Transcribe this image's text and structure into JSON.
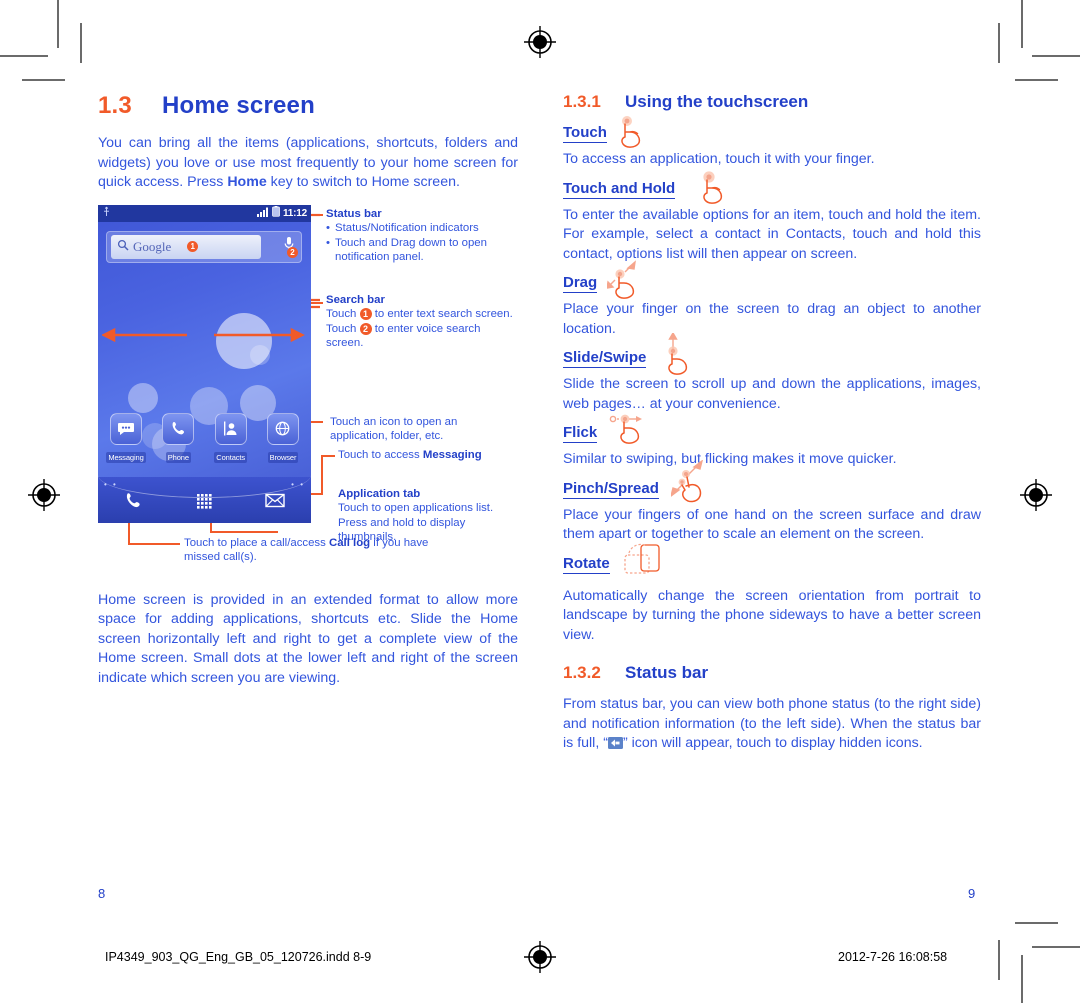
{
  "document": {
    "left_page_number": "8",
    "right_page_number": "9",
    "footer_filename": "IP4349_903_QG_Eng_GB_05_120726.indd   8-9",
    "footer_timestamp": "2012-7-26   16:08:58"
  },
  "colors": {
    "accent_orange": "#F15A29",
    "heading_blue": "#2340C8",
    "body_blue": "#3355DD",
    "phone_bg": "#4a63e0",
    "status_bar": "#21379f"
  },
  "left_column": {
    "section": {
      "number": "1.3",
      "title": "Home screen"
    },
    "intro_paragraph": "You can bring all the items (applications, shortcuts, folders and widgets) you love or use most frequently to your home screen for quick access. Press ",
    "intro_bold": "Home",
    "intro_paragraph_tail": " key to switch to Home screen.",
    "closing_paragraph": "Home screen is provided in an extended format to allow more space for adding applications, shortcuts etc. Slide the Home screen horizontally left and right to get a complete view of the Home screen. Small dots at the lower left and right of the screen indicate which screen you are viewing."
  },
  "phone": {
    "status_bar": {
      "time": "11:12",
      "usb_icon": "usb-icon",
      "signal_icon": "signal-bars-icon",
      "battery_icon": "battery-icon"
    },
    "search_bar": {
      "search_icon": "magnifier-icon",
      "text": "Google",
      "badge_text": "1",
      "mic_icon": "microphone-icon",
      "badge_voice": "2"
    },
    "dock_apps": [
      {
        "label": "Messaging",
        "icon": "message-bubble-icon"
      },
      {
        "label": "Phone",
        "icon": "handset-icon"
      },
      {
        "label": "Contacts",
        "icon": "person-icon"
      },
      {
        "label": "Browser",
        "icon": "globe-icon"
      }
    ],
    "bottom_bar": [
      {
        "icon": "phone-handset-icon",
        "name": "call-log-button"
      },
      {
        "icon": "app-grid-icon",
        "name": "application-tab-button"
      },
      {
        "icon": "envelope-icon",
        "name": "messaging-button"
      }
    ],
    "page_dots_left": "• •",
    "page_dots_right": "• •"
  },
  "annotations": {
    "status_bar": {
      "title": "Status bar",
      "bullets": [
        "Status/Notification indicators",
        "Touch and Drag down to open notification panel."
      ]
    },
    "search_bar": {
      "title": "Search bar",
      "line1_pre": "Touch ",
      "line1_badge": "1",
      "line1_post": " to enter text search screen.",
      "line2_pre": "Touch ",
      "line2_badge": "2",
      "line2_post": " to enter voice search screen."
    },
    "icon_note": "Touch an icon to open an application, folder, etc.",
    "messaging_note_pre": "Touch to access ",
    "messaging_note_bold": "Messaging",
    "application_tab": {
      "title": "Application tab",
      "body": "Touch to open applications list. Press and hold to display thumbnails."
    },
    "call_log_note_pre": "Touch to place a call/access ",
    "call_log_note_bold": "Call log",
    "call_log_note_post": " if you have missed call(s)."
  },
  "right_column": {
    "section_1": {
      "number": "1.3.1",
      "title": "Using the touchscreen"
    },
    "gestures": [
      {
        "name": "Touch",
        "icon": "hand-touch-icon",
        "body": "To access an application, touch it with your finger."
      },
      {
        "name": "Touch and Hold ",
        "icon": "hand-touch-hold-icon",
        "body": "To enter the available options for an item, touch and hold the item. For example, select a contact in Contacts, touch and hold this contact, options list will then appear on screen."
      },
      {
        "name": "Drag",
        "icon": "hand-drag-icon",
        "body": "Place your finger on the screen to drag an object to another location."
      },
      {
        "name": "Slide/Swipe",
        "icon": "hand-slide-icon",
        "body": "Slide the screen to scroll up and down the applications, images, web pages… at your convenience."
      },
      {
        "name": "Flick",
        "icon": "hand-flick-icon",
        "body": "Similar to swiping, but flicking makes it move quicker."
      },
      {
        "name": "Pinch/Spread",
        "icon": "hand-pinch-spread-icon",
        "body": "Place your fingers of one hand on the screen surface and draw them apart or together to scale an element on the screen."
      },
      {
        "name": "Rotate",
        "icon": "rotate-screen-icon",
        "body": "Automatically change the screen orientation from portrait to landscape by turning the phone sideways to have a better screen view."
      }
    ],
    "section_2": {
      "number": "1.3.2",
      "title": "Status bar"
    },
    "status_bar_para_pre": "From status bar, you can view both phone status (to the right side) and notification information (to the left side). When the status bar is full, “",
    "status_bar_para_post": "”  icon will appear, touch to display hidden icons."
  }
}
